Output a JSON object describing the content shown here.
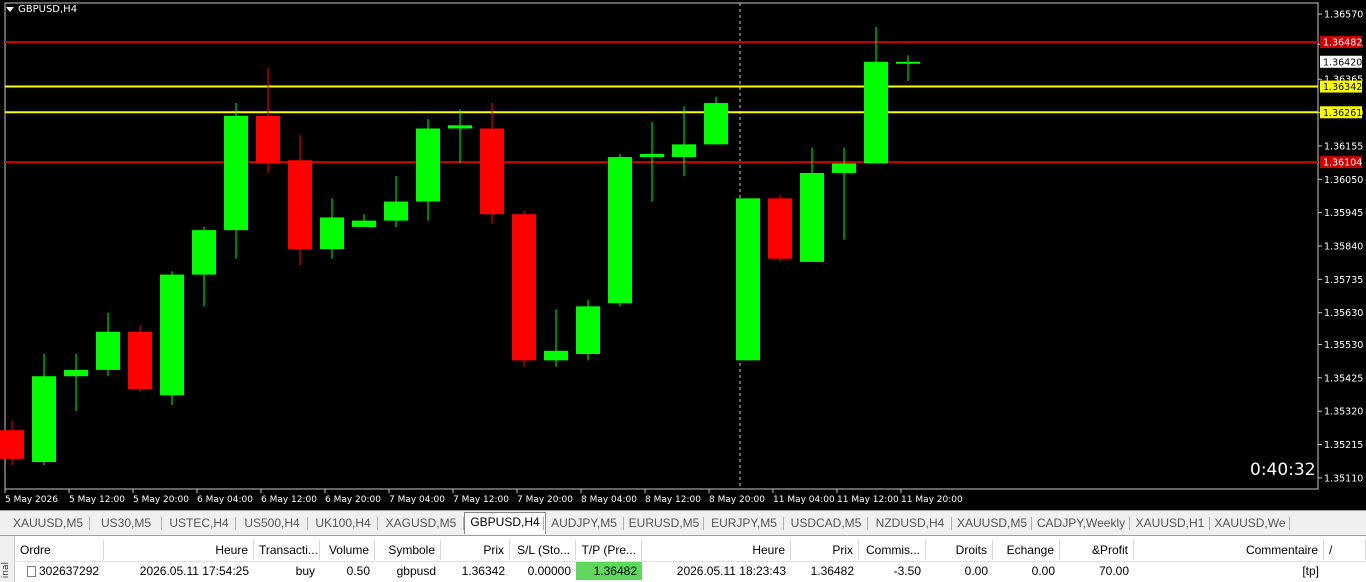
{
  "title": "GBPUSD,H4",
  "timer": "0:40:32",
  "colors": {
    "bull": "#00ff00",
    "bear": "#ff0000",
    "yellow_line": "#ffff00",
    "red_line": "#cc0000",
    "background": "#000000"
  },
  "chart_data": {
    "type": "candlestick",
    "symbol": "GBPUSD",
    "timeframe": "H4",
    "ylim": [
      1.35075,
      1.36605
    ],
    "y_ticks": [
      "1.36570",
      "1.36475",
      "1.36365",
      "1.36260",
      "1.36155",
      "1.36050",
      "1.35945",
      "1.35840",
      "1.35735",
      "1.35630",
      "1.35530",
      "1.35425",
      "1.35320",
      "1.35215",
      "1.35110"
    ],
    "x_labels": [
      "5 May 2026",
      "5 May 12:00",
      "5 May 20:00",
      "6 May 04:00",
      "6 May 12:00",
      "6 May 20:00",
      "7 May 04:00",
      "7 May 12:00",
      "7 May 20:00",
      "8 May 04:00",
      "8 May 12:00",
      "8 May 20:00",
      "11 May 04:00",
      "11 May 12:00",
      "11 May 20:00"
    ],
    "candles": [
      {
        "o": 1.3526,
        "h": 1.3529,
        "l": 1.3515,
        "c": 1.3517
      },
      {
        "o": 1.3516,
        "h": 1.355,
        "l": 1.3515,
        "c": 1.3543
      },
      {
        "o": 1.3543,
        "h": 1.355,
        "l": 1.3532,
        "c": 1.3545
      },
      {
        "o": 1.3545,
        "h": 1.3563,
        "l": 1.3543,
        "c": 1.3557
      },
      {
        "o": 1.3557,
        "h": 1.3559,
        "l": 1.3538,
        "c": 1.3539
      },
      {
        "o": 1.3537,
        "h": 1.3576,
        "l": 1.3534,
        "c": 1.3575
      },
      {
        "o": 1.3575,
        "h": 1.359,
        "l": 1.3565,
        "c": 1.3589
      },
      {
        "o": 1.3589,
        "h": 1.3629,
        "l": 1.358,
        "c": 1.3625
      },
      {
        "o": 1.3625,
        "h": 1.364,
        "l": 1.3607,
        "c": 1.361
      },
      {
        "o": 1.3611,
        "h": 1.3619,
        "l": 1.3578,
        "c": 1.3583
      },
      {
        "o": 1.3583,
        "h": 1.3599,
        "l": 1.358,
        "c": 1.3593
      },
      {
        "o": 1.359,
        "h": 1.3594,
        "l": 1.359,
        "c": 1.3592
      },
      {
        "o": 1.3592,
        "h": 1.3606,
        "l": 1.359,
        "c": 1.3598
      },
      {
        "o": 1.3598,
        "h": 1.3624,
        "l": 1.3592,
        "c": 1.3621
      },
      {
        "o": 1.3621,
        "h": 1.3627,
        "l": 1.361,
        "c": 1.3622
      },
      {
        "o": 1.3621,
        "h": 1.3629,
        "l": 1.3591,
        "c": 1.3594
      },
      {
        "o": 1.3594,
        "h": 1.3595,
        "l": 1.3546,
        "c": 1.3548
      },
      {
        "o": 1.3548,
        "h": 1.3564,
        "l": 1.3546,
        "c": 1.3551
      },
      {
        "o": 1.355,
        "h": 1.3567,
        "l": 1.3548,
        "c": 1.3565
      },
      {
        "o": 1.3566,
        "h": 1.3613,
        "l": 1.3565,
        "c": 1.3612
      },
      {
        "o": 1.3612,
        "h": 1.3623,
        "l": 1.3598,
        "c": 1.3613
      },
      {
        "o": 1.3612,
        "h": 1.3628,
        "l": 1.3606,
        "c": 1.3616
      },
      {
        "o": 1.3616,
        "h": 1.3631,
        "l": 1.3616,
        "c": 1.3629
      },
      {
        "o": 1.3548,
        "h": 1.3599,
        "l": 1.3548,
        "c": 1.3599
      },
      {
        "o": 1.3599,
        "h": 1.36,
        "l": 1.3579,
        "c": 1.358
      },
      {
        "o": 1.3579,
        "h": 1.3615,
        "l": 1.3579,
        "c": 1.3607
      },
      {
        "o": 1.3607,
        "h": 1.3615,
        "l": 1.3586,
        "c": 1.361
      },
      {
        "o": 1.361,
        "h": 1.3653,
        "l": 1.361,
        "c": 1.3642
      },
      {
        "o": 1.3642,
        "h": 1.3644,
        "l": 1.3636,
        "c": 1.3642
      }
    ],
    "hlines": [
      {
        "price": 1.36482,
        "label": "1.36482",
        "color": "#cc0000",
        "tag_bg": "#cc0000",
        "tag_fg": "#ffffff"
      },
      {
        "price": 1.36342,
        "label": "1.36342",
        "color": "#ffff00",
        "tag_bg": "#ffff00",
        "tag_fg": "#000000"
      },
      {
        "price": 1.36261,
        "label": "1.36261",
        "color": "#ffff00",
        "tag_bg": "#ffff00",
        "tag_fg": "#000000"
      },
      {
        "price": 1.36104,
        "label": "1.36104",
        "color": "#cc0000",
        "tag_bg": "#cc0000",
        "tag_fg": "#ffffff"
      }
    ],
    "bid": {
      "price": 1.3642,
      "label": "1.36420"
    }
  },
  "tabs": [
    "XAUUSD,M5",
    "US30,M5",
    "USTEC,H4",
    "US500,H4",
    "UK100,H4",
    "XAGUSD,M5",
    "GBPUSD,H4",
    "AUDJPY,M5",
    "EURUSD,M5",
    "EURJPY,M5",
    "USDCAD,M5",
    "NZDUSD,H4",
    "XAUUSD,M5",
    "CADJPY,Weekly",
    "XAUUSD,H1",
    "XAUUSD,We"
  ],
  "active_tab": "GBPUSD,H4",
  "terminal": {
    "side_label": "inal",
    "headers": [
      "Ordre",
      "Heure",
      "Transacti...",
      "Volume",
      "Symbole",
      "Prix",
      "S/L (Sto...",
      "T/P (Pre...",
      "Heure",
      "Prix",
      "Commis...",
      "Droits",
      "Echange",
      "&Profit",
      "Commentaire",
      "/"
    ],
    "row": [
      "302637292",
      "2026.05.11 17:54:25",
      "buy",
      "0.50",
      "gbpusd",
      "1.36342",
      "0.00000",
      "1.36482",
      "2026.05.11 18:23:43",
      "1.36482",
      "-3.50",
      "0.00",
      "0.00",
      "70.00",
      "[tp]"
    ]
  }
}
